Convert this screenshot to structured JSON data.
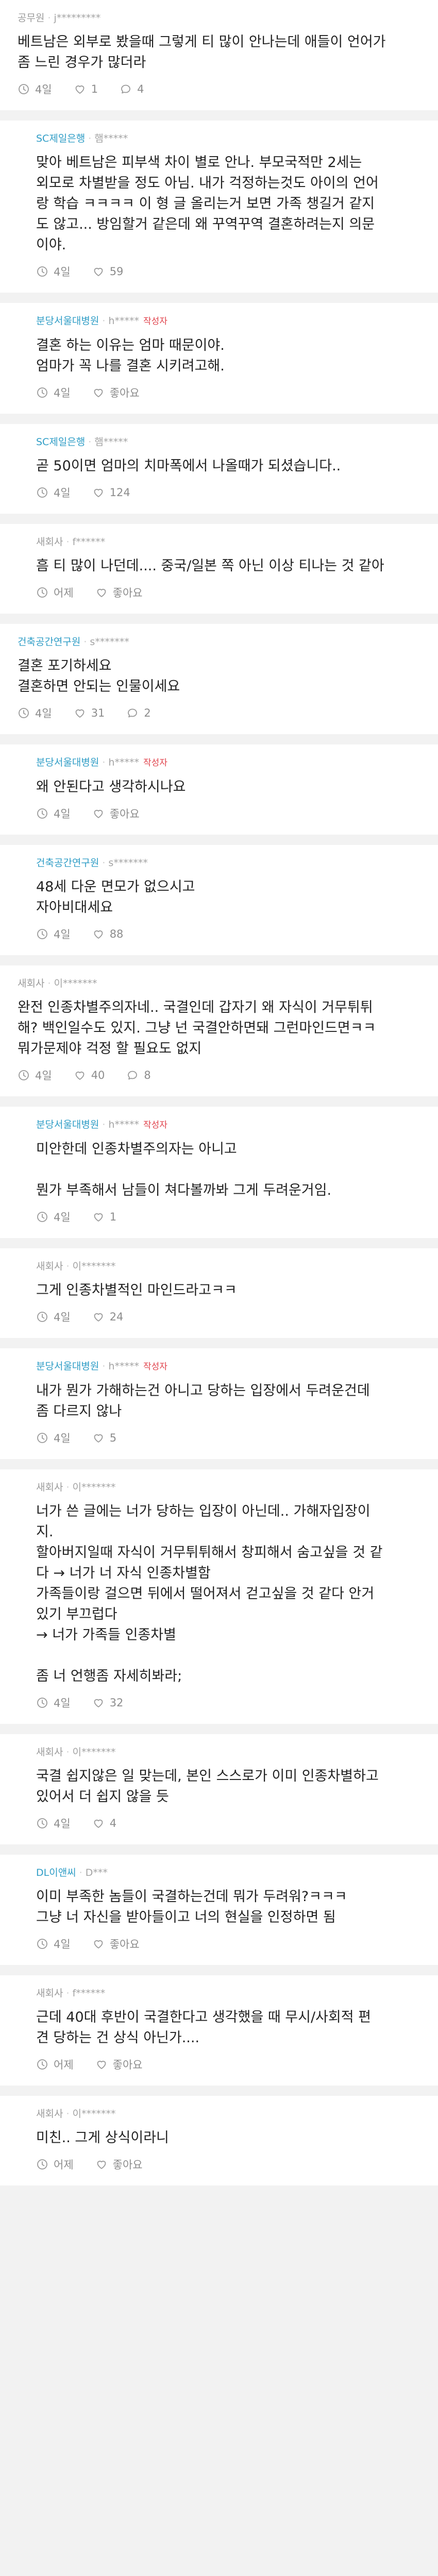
{
  "icons": {
    "time": "clock-icon",
    "like": "heart-icon",
    "reply": "speech-bubble-icon"
  },
  "colors": {
    "company_blue": "#2f9dc6",
    "author_badge": "#e0424b",
    "meta_gray": "#a3a3a3",
    "background": "#f2f2f2"
  },
  "comments": [
    {
      "company": "공무원",
      "blue": false,
      "author": "j*********",
      "badge": "",
      "indent": false,
      "text": "베트남은 외부로 봤을때 그렇게 티 많이 안나는데 애들이 언어가\n좀 느린 경우가 많더라",
      "time": "4일",
      "likes": "1",
      "replies": "4"
    },
    {
      "company": "SC제일은행",
      "blue": true,
      "author": "햄*****",
      "badge": "",
      "indent": true,
      "text": "맞아 베트남은 피부색 차이 별로 안나. 부모국적만 2세는\n외모로 차별받을 정도 아님. 내가 걱정하는것도 아이의 언어\n랑 학습 ㅋㅋㅋㅋ 이 형 글 올리는거 보면 가족 챙길거 같지\n도 않고... 방임할거 같은데 왜 꾸역꾸역 결혼하려는지 의문\n이야.",
      "time": "4일",
      "likes": "59",
      "replies": ""
    },
    {
      "company": "분당서울대병원",
      "blue": true,
      "author": "h*****",
      "badge": "작성자",
      "indent": true,
      "text": "결혼 하는 이유는 엄마 때문이야.\n엄마가 꼭 나를 결혼 시키려고해.",
      "time": "4일",
      "likes": "좋아요",
      "replies": ""
    },
    {
      "company": "SC제일은행",
      "blue": true,
      "author": "햄*****",
      "badge": "",
      "indent": true,
      "text": "곧 50이면 엄마의 치마폭에서 나올때가 되셨습니다..",
      "time": "4일",
      "likes": "124",
      "replies": ""
    },
    {
      "company": "새회사",
      "blue": false,
      "author": "f******",
      "badge": "",
      "indent": true,
      "text": "흠 티 많이 나던데.... 중국/일본 쪽 아닌 이상 티나는 것 같아",
      "time": "어제",
      "likes": "좋아요",
      "replies": ""
    },
    {
      "company": "건축공간연구원",
      "blue": true,
      "author": "s*******",
      "badge": "",
      "indent": false,
      "text": "결혼 포기하세요\n결혼하면 안되는 인물이세요",
      "time": "4일",
      "likes": "31",
      "replies": "2"
    },
    {
      "company": "분당서울대병원",
      "blue": true,
      "author": "h*****",
      "badge": "작성자",
      "indent": true,
      "text": "왜 안된다고 생각하시나요",
      "time": "4일",
      "likes": "좋아요",
      "replies": ""
    },
    {
      "company": "건축공간연구원",
      "blue": true,
      "author": "s*******",
      "badge": "",
      "indent": true,
      "text": "48세 다운 면모가 없으시고\n자아비대세요",
      "time": "4일",
      "likes": "88",
      "replies": ""
    },
    {
      "company": "새회사",
      "blue": false,
      "author": "이*******",
      "badge": "",
      "indent": false,
      "text": "완전 인종차별주의자네.. 국결인데 갑자기 왜 자식이 거무튀튀\n해? 백인일수도 있지. 그냥 넌 국결안하면돼 그런마인드면ㅋㅋ\n뭐가문제야 걱정 할 필요도 없지",
      "time": "4일",
      "likes": "40",
      "replies": "8"
    },
    {
      "company": "분당서울대병원",
      "blue": true,
      "author": "h*****",
      "badge": "작성자",
      "indent": true,
      "text": "미안한데 인종차별주의자는 아니고\n\n뭔가 부족해서 남들이 쳐다볼까봐 그게 두려운거임.",
      "time": "4일",
      "likes": "1",
      "replies": ""
    },
    {
      "company": "새회사",
      "blue": false,
      "author": "이*******",
      "badge": "",
      "indent": true,
      "text": "그게 인종차별적인 마인드라고ㅋㅋ",
      "time": "4일",
      "likes": "24",
      "replies": ""
    },
    {
      "company": "분당서울대병원",
      "blue": true,
      "author": "h*****",
      "badge": "작성자",
      "indent": true,
      "text": "내가 뭔가 가해하는건 아니고 당하는 입장에서 두려운건데\n좀 다르지 않나",
      "time": "4일",
      "likes": "5",
      "replies": ""
    },
    {
      "company": "새회사",
      "blue": false,
      "author": "이*******",
      "badge": "",
      "indent": true,
      "text": "너가 쓴 글에는 너가 당하는 입장이 아닌데.. 가해자입장이\n지.\n할아버지일때 자식이 거무튀튀해서 창피해서 숨고싶을 것 같\n다 → 너가 너 자식 인종차별함\n가족들이랑 걸으면 뒤에서 떨어져서 걷고싶을 것 같다 안거\n있기 부끄럽다\n→ 너가 가족들 인종차별\n\n좀 너 언행좀 자세히봐라;",
      "time": "4일",
      "likes": "32",
      "replies": ""
    },
    {
      "company": "새회사",
      "blue": false,
      "author": "이*******",
      "badge": "",
      "indent": true,
      "text": "국결 쉽지않은 일 맞는데, 본인 스스로가 이미 인종차별하고\n있어서 더 쉽지 않을 듯",
      "time": "4일",
      "likes": "4",
      "replies": ""
    },
    {
      "company": "DL이앤씨",
      "blue": true,
      "author": "D***",
      "badge": "",
      "indent": true,
      "text": "이미 부족한 놈들이 국결하는건데 뭐가 두려워?ㅋㅋㅋ\n그냥 너 자신을 받아들이고 너의 현실을 인정하면 됨",
      "time": "4일",
      "likes": "좋아요",
      "replies": ""
    },
    {
      "company": "새회사",
      "blue": false,
      "author": "f******",
      "badge": "",
      "indent": true,
      "text": "근데 40대 후반이 국결한다고 생각했을 때 무시/사회적 편\n견 당하는 건 상식 아닌가....",
      "time": "어제",
      "likes": "좋아요",
      "replies": ""
    },
    {
      "company": "새회사",
      "blue": false,
      "author": "이*******",
      "badge": "",
      "indent": true,
      "text": "미친.. 그게 상식이라니",
      "time": "어제",
      "likes": "좋아요",
      "replies": ""
    }
  ]
}
